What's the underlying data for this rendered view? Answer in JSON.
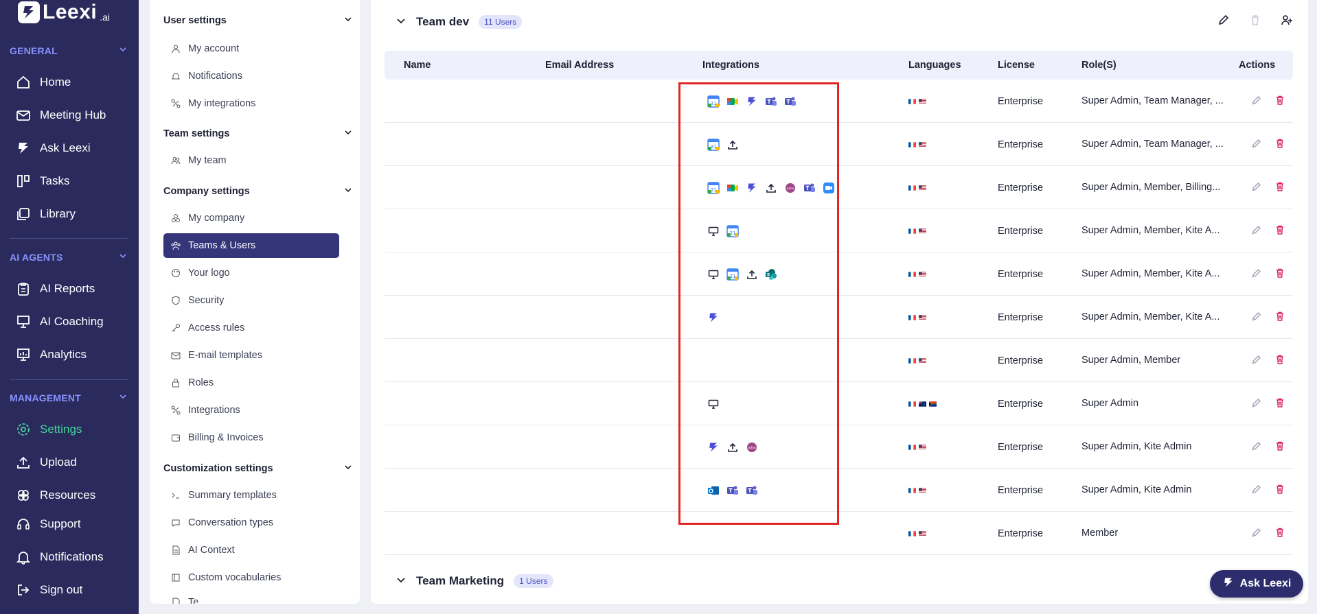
{
  "brand": {
    "name": "Leexi",
    "suffix": ".ai"
  },
  "nav": {
    "sections": [
      {
        "label": "GENERAL",
        "items": [
          {
            "label": "Home",
            "icon": "home-icon"
          },
          {
            "label": "Meeting Hub",
            "icon": "mail-icon"
          },
          {
            "label": "Ask Leexi",
            "icon": "leexi-icon"
          },
          {
            "label": "Tasks",
            "icon": "tasks-icon"
          },
          {
            "label": "Library",
            "icon": "library-icon"
          }
        ]
      },
      {
        "label": "AI AGENTS",
        "items": [
          {
            "label": "AI Reports",
            "icon": "clipboard-icon"
          },
          {
            "label": "AI Coaching",
            "icon": "coaching-icon"
          },
          {
            "label": "Analytics",
            "icon": "analytics-icon"
          }
        ]
      },
      {
        "label": "MANAGEMENT",
        "items": [
          {
            "label": "Settings",
            "icon": "gear-icon",
            "active": true
          },
          {
            "label": "Upload",
            "icon": "upload-icon"
          },
          {
            "label": "Resources",
            "icon": "resources-icon"
          },
          {
            "label": "Support",
            "icon": "headset-icon"
          },
          {
            "label": "Notifications",
            "icon": "bell-icon"
          },
          {
            "label": "Sign out",
            "icon": "signout-icon"
          }
        ]
      }
    ]
  },
  "settings": {
    "groups": [
      {
        "label": "User settings",
        "items": [
          "My account",
          "Notifications",
          "My integrations"
        ]
      },
      {
        "label": "Team settings",
        "items": [
          "My team"
        ]
      },
      {
        "label": "Company settings",
        "items": [
          "My company",
          "Teams & Users",
          "Your logo",
          "Security",
          "Access rules",
          "E-mail templates",
          "Roles",
          "Integrations",
          "Billing & Invoices"
        ]
      },
      {
        "label": "Customization settings",
        "items": [
          "Summary templates",
          "Conversation types",
          "AI Context",
          "Custom vocabularies",
          "Te..."
        ]
      }
    ],
    "active_item": "Teams & Users"
  },
  "team_dev": {
    "name": "Team dev",
    "users_badge": "11 Users",
    "columns": [
      "Name",
      "Email Address",
      "Integrations",
      "Languages",
      "License",
      "Role(S)",
      "Actions"
    ],
    "rows": [
      {
        "integrations": [
          "google-calendar-icon",
          "google-meet-icon",
          "leexi-icon",
          "teams-icon",
          "teams-icon"
        ],
        "languages": [
          "fr",
          "us"
        ],
        "license": "Enterprise",
        "roles": "Super Admin, Team Manager, ..."
      },
      {
        "integrations": [
          "google-calendar-icon",
          "upload-icon"
        ],
        "languages": [
          "fr",
          "us"
        ],
        "license": "Enterprise",
        "roles": "Super Admin, Team Manager, ..."
      },
      {
        "integrations": [
          "google-calendar-icon",
          "google-meet-icon",
          "leexi-icon",
          "upload-icon",
          "odoo-icon",
          "teams-icon",
          "zoom-icon"
        ],
        "languages": [
          "fr",
          "us"
        ],
        "license": "Enterprise",
        "roles": "Super Admin, Member, Billing..."
      },
      {
        "integrations": [
          "desktop-icon",
          "google-calendar-icon"
        ],
        "languages": [
          "fr",
          "us"
        ],
        "license": "Enterprise",
        "roles": "Super Admin, Member, Kite A..."
      },
      {
        "integrations": [
          "desktop-icon",
          "google-calendar-icon",
          "upload-icon",
          "sharepoint-icon"
        ],
        "languages": [
          "fr",
          "us"
        ],
        "license": "Enterprise",
        "roles": "Super Admin, Member, Kite A..."
      },
      {
        "integrations": [
          "leexi-icon"
        ],
        "languages": [
          "fr",
          "us"
        ],
        "license": "Enterprise",
        "roles": "Super Admin, Member, Kite A..."
      },
      {
        "integrations": [],
        "languages": [
          "fr",
          "us"
        ],
        "license": "Enterprise",
        "roles": "Super Admin, Member"
      },
      {
        "integrations": [
          "desktop-icon"
        ],
        "languages": [
          "fr",
          "au",
          "za"
        ],
        "license": "Enterprise",
        "roles": "Super Admin"
      },
      {
        "integrations": [
          "leexi-icon",
          "upload-icon",
          "odoo-icon"
        ],
        "languages": [
          "fr",
          "us"
        ],
        "license": "Enterprise",
        "roles": "Super Admin, Kite Admin"
      },
      {
        "integrations": [
          "outlook-icon",
          "teams-icon",
          "teams-icon"
        ],
        "languages": [
          "fr",
          "us"
        ],
        "license": "Enterprise",
        "roles": "Super Admin, Kite Admin"
      },
      {
        "integrations": [],
        "languages": [
          "fr",
          "us"
        ],
        "license": "Enterprise",
        "roles": "Member"
      }
    ]
  },
  "team_marketing": {
    "name": "Team Marketing",
    "users_badge": "1 Users"
  },
  "ask_button": {
    "label": "Ask Leexi"
  },
  "colors": {
    "nav_bg": "#2a2a5c",
    "accent": "#35357a",
    "active_green": "#45d49b",
    "danger": "#e0245e",
    "highlight": "#e32424"
  }
}
